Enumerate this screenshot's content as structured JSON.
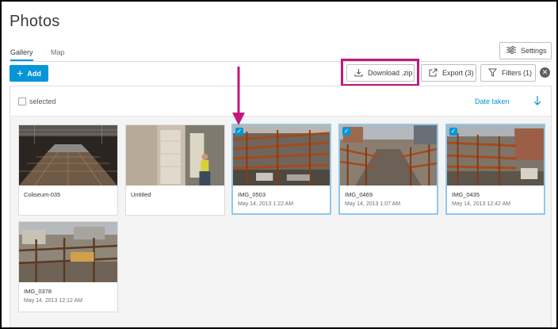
{
  "page": {
    "title": "Photos"
  },
  "tabs": [
    {
      "label": "Gallery",
      "active": true
    },
    {
      "label": "Map",
      "active": false
    }
  ],
  "settings": {
    "label": "Settings",
    "icon": "sliders-icon"
  },
  "toolbar": {
    "add_label": "Add",
    "download_label": "Download .zip",
    "export_label": "Export (3)",
    "filters_label": "Filters (1)"
  },
  "gallery": {
    "selected_label": "selected",
    "sort_label": "Date taken",
    "photos": [
      {
        "name": "Coliseum-035",
        "date": "",
        "selected": false
      },
      {
        "name": "Untitled",
        "date": "",
        "selected": false
      },
      {
        "name": "IMG_0503",
        "date": "May 14, 2013 1:22 AM",
        "selected": true
      },
      {
        "name": "IMG_0469",
        "date": "May 14, 2013 1:07 AM",
        "selected": true
      },
      {
        "name": "IMG_0435",
        "date": "May 14, 2013 12:42 AM",
        "selected": true
      },
      {
        "name": "IMG_0378",
        "date": "May 14, 2013 12:12 AM",
        "selected": false
      }
    ]
  },
  "colors": {
    "accent": "#0696d7",
    "annotation": "#c2187a",
    "selection_border": "#8fc8ec"
  }
}
